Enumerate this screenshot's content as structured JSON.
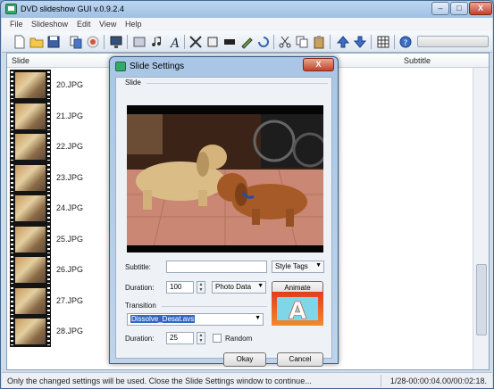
{
  "window": {
    "title": "DVD slideshow GUI v.0.9.2.4",
    "min_label": "–",
    "max_label": "□",
    "close_label": "X"
  },
  "menu": [
    "File",
    "Slideshow",
    "Edit",
    "View",
    "Help"
  ],
  "toolbar": {
    "icons": [
      "new-icon",
      "open-icon",
      "save-icon",
      "copy-icon",
      "burn-icon",
      "monitor-icon",
      "slides-icon",
      "music-icon",
      "text-icon",
      "cut-effect-icon",
      "crop-icon",
      "film-icon",
      "brush-icon",
      "rotate-icon",
      "scissors-icon",
      "copy2-icon",
      "paste-icon",
      "up-arrow-icon",
      "down-arrow-icon",
      "grid-icon",
      "help-icon"
    ]
  },
  "list": {
    "columns": {
      "slide": "Slide",
      "subtitle": "Subtitle"
    },
    "rows": [
      "20.JPG",
      "21.JPG",
      "22.JPG",
      "23.JPG",
      "24.JPG",
      "25.JPG",
      "26.JPG",
      "27.JPG",
      "28.JPG"
    ]
  },
  "status": {
    "message": "Only the changed settings will be used. Close the Slide Settings window to continue...",
    "time": "1/28-00:00:04.00/00:02:18."
  },
  "dialog": {
    "title": "Slide Settings",
    "close_label": "X",
    "slide_group": "Slide",
    "subtitle_label": "Subtitle:",
    "subtitle_value": "",
    "style_tags": "Style Tags",
    "duration_label": "Duration:",
    "duration_value": "100",
    "photo_data": "Photo Data",
    "animate": "Animate",
    "transition_group": "Transition",
    "transition_value": "Dissolve_Desat.avs",
    "transition_duration_label": "Duration:",
    "transition_duration_value": "25",
    "random_label": "Random",
    "random_checked": false,
    "okay": "Okay",
    "cancel": "Cancel",
    "logo_letter": "A"
  }
}
